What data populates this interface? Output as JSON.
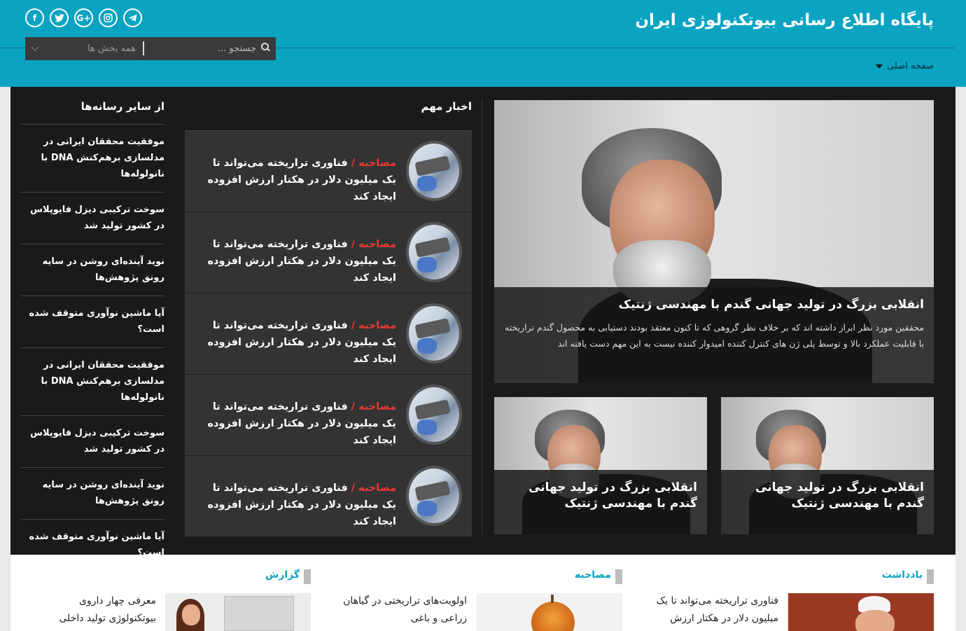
{
  "header": {
    "site_title": "پایگاه اطلاع رسانی بیوتکنولوژی ایران",
    "social_icons": [
      "telegram-icon",
      "instagram-icon",
      "google-plus-icon",
      "twitter-icon",
      "facebook-icon"
    ],
    "search": {
      "placeholder": "جستجو ...",
      "category": "همه بخش ها"
    },
    "nav": {
      "home_label": "صفحه اصلی"
    },
    "colors": {
      "header_bg": "#0aa3c2",
      "dark_bg": "#1a1a1a",
      "tag_red": "#e53935"
    }
  },
  "feature": {
    "title": "انقلابی بزرگ در تولید جهانی گندم با مهندسی ژنتیک",
    "desc": "محققین مورد نظر ابراز داشته اند که بر خلاف نظر گروهی که تا کنون معتقد بودند دستیابی به محصول گندم تراریخته با قابلیت عملکرد بالا و توسط پلی ژن های کنترل کننده امیدوار کننده نیست به این مهم دست یافته اند"
  },
  "small_cards": [
    {
      "title": "انقلابی بزرگ در تولید جهانی گندم با مهندسی ژنتیک"
    },
    {
      "title": "انقلابی بزرگ در تولید جهانی گندم با مهندسی ژنتیک"
    }
  ],
  "important_news": {
    "heading": "اخبار مهم",
    "items": [
      {
        "tag": "مصاحبه",
        "sep": " / ",
        "title": "فناوری تراریخته می‌تواند تا یک میلیون دلار در هکتار ارزش افزوده ایجاد کند"
      },
      {
        "tag": "مصاحبه",
        "sep": " / ",
        "title": "فناوری تراریخته می‌تواند تا یک میلیون دلار در هکتار ارزش افزوده ایجاد کند"
      },
      {
        "tag": "مصاحبه",
        "sep": " / ",
        "title": "فناوری تراریخته می‌تواند تا یک میلیون دلار در هکتار ارزش افزوده ایجاد کند"
      },
      {
        "tag": "مصاحبه",
        "sep": " / ",
        "title": "فناوری تراریخته می‌تواند تا یک میلیون دلار در هکتار ارزش افزوده ایجاد کند"
      },
      {
        "tag": "مصاحبه",
        "sep": " / ",
        "title": "فناوری تراریخته می‌تواند تا یک میلیون دلار در هکتار ارزش افزوده ایجاد کند"
      }
    ]
  },
  "other_media": {
    "heading": "از سایر رسانه‌ها",
    "items": [
      "موفقیت محققان ایرانی در مدلسازی برهم‌کنش DNA با نانولوله‌ها",
      "سوخت ترکیبی دیزل فایوپلاس در کشور تولید شد",
      "نوید آینده‌ای روشن در سایه رونق پژوهش‌ها",
      "آیا ماشین نوآوری متوقف شده است؟",
      "موفقیت محققان ایرانی در مدلسازی برهم‌کنش DNA با نانولوله‌ها",
      "سوخت ترکیبی دیزل فایوپلاس در کشور تولید شد",
      "نوید آینده‌ای روشن در سایه رونق پژوهش‌ها",
      "آیا ماشین نوآوری متوقف شده است؟"
    ]
  },
  "sections": [
    {
      "label": "یادداشت",
      "text": "فناوری تراریخته می‌تواند تا یک میلیون دلار در هکتار ارزش"
    },
    {
      "label": "مصاحبه",
      "text": "اولویت‌های تراریختی در گیاهان زراعی و باغی"
    },
    {
      "label": "گزارش",
      "text": "معرفی چهار داروی بیوتکنولوژی تولید داخلی"
    }
  ]
}
